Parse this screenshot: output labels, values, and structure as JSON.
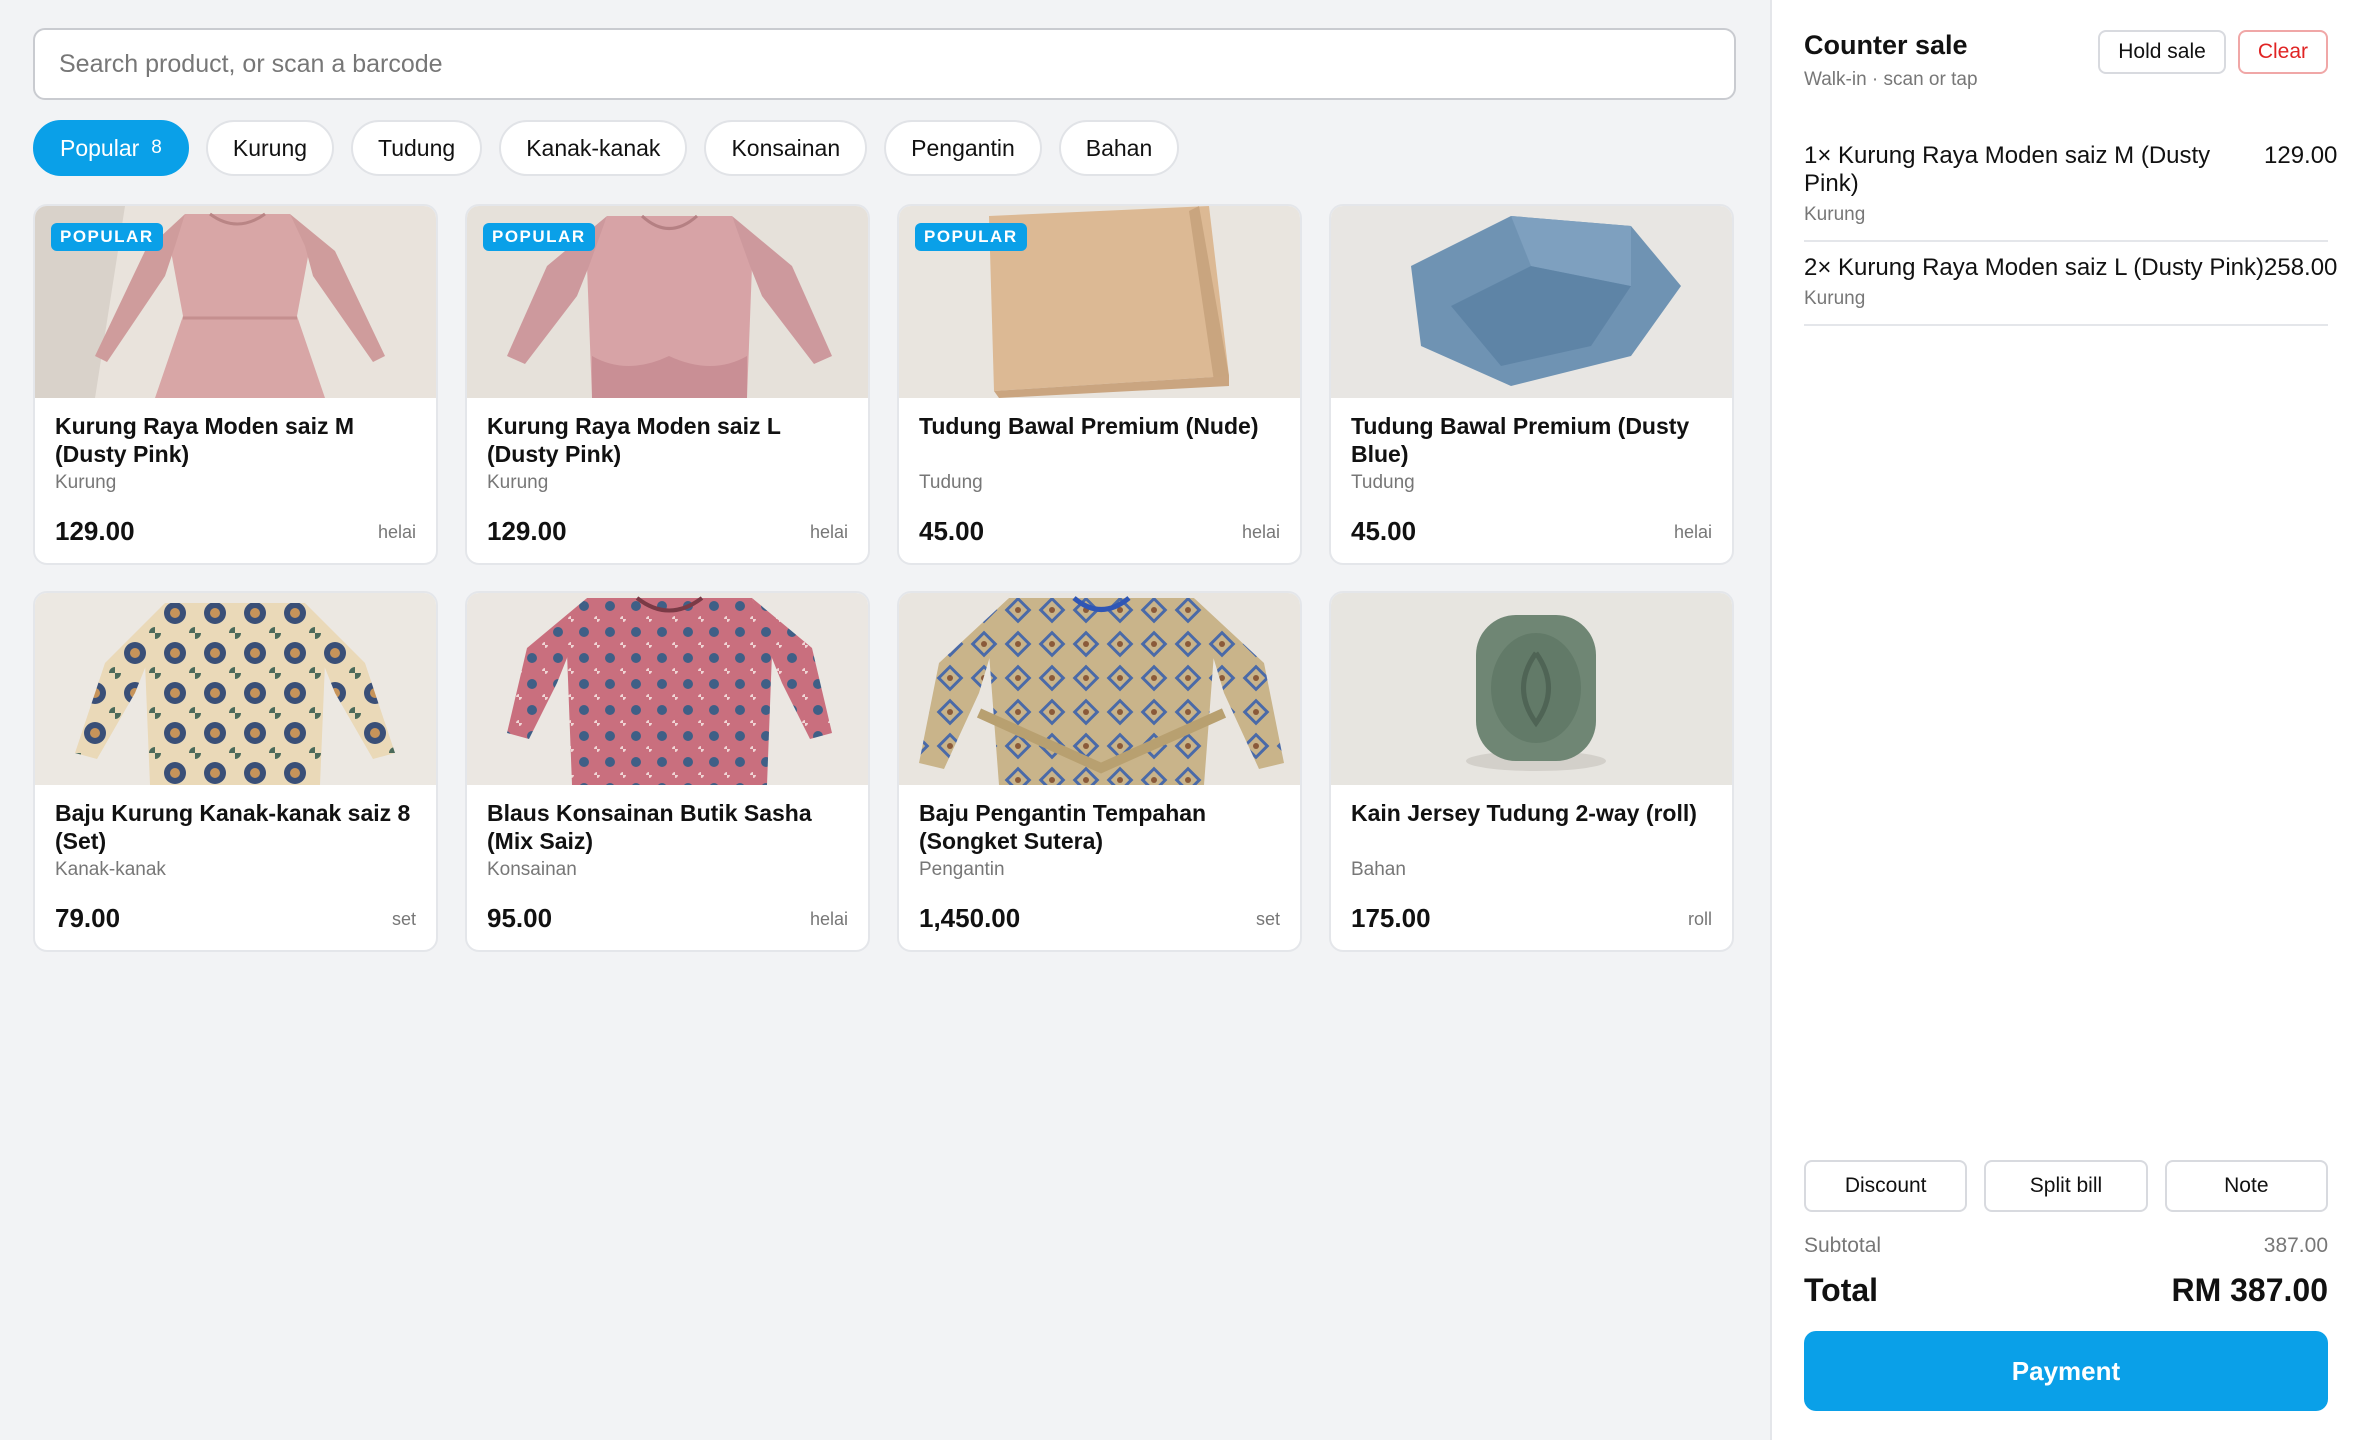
{
  "search": {
    "placeholder": "Search product, or scan a barcode"
  },
  "categories": [
    {
      "label": "Popular",
      "count": "8",
      "active": true
    },
    {
      "label": "Kurung"
    },
    {
      "label": "Tudung"
    },
    {
      "label": "Kanak-kanak"
    },
    {
      "label": "Konsainan"
    },
    {
      "label": "Pengantin"
    },
    {
      "label": "Bahan"
    }
  ],
  "products": [
    {
      "name": "Kurung Raya Moden saiz M (Dusty Pink)",
      "category": "Kurung",
      "price": "129.00",
      "unit": "helai",
      "badge": "POPULAR"
    },
    {
      "name": "Kurung Raya Moden saiz L (Dusty Pink)",
      "category": "Kurung",
      "price": "129.00",
      "unit": "helai",
      "badge": "POPULAR"
    },
    {
      "name": "Tudung Bawal Premium (Nude)",
      "category": "Tudung",
      "price": "45.00",
      "unit": "helai",
      "badge": "POPULAR"
    },
    {
      "name": "Tudung Bawal Premium (Dusty Blue)",
      "category": "Tudung",
      "price": "45.00",
      "unit": "helai"
    },
    {
      "name": "Baju Kurung Kanak-kanak saiz 8 (Set)",
      "category": "Kanak-kanak",
      "price": "79.00",
      "unit": "set"
    },
    {
      "name": "Blaus Konsainan Butik Sasha (Mix Saiz)",
      "category": "Konsainan",
      "price": "95.00",
      "unit": "helai"
    },
    {
      "name": "Baju Pengantin Tempahan (Songket Sutera)",
      "category": "Pengantin",
      "price": "1,450.00",
      "unit": "set"
    },
    {
      "name": "Kain Jersey Tudung 2-way (roll)",
      "category": "Bahan",
      "price": "175.00",
      "unit": "roll"
    }
  ],
  "cart": {
    "title": "Counter sale",
    "subtitle": "Walk-in · scan or tap",
    "hold_label": "Hold sale",
    "clear_label": "Clear",
    "lines": [
      {
        "qty_name": "1× Kurung Raya Moden saiz M (Dusty Pink)",
        "category": "Kurung",
        "amount": "129.00"
      },
      {
        "qty_name": "2× Kurung Raya Moden saiz L (Dusty Pink)",
        "category": "Kurung",
        "amount": "258.00"
      }
    ],
    "discount_label": "Discount",
    "split_label": "Split bill",
    "note_label": "Note",
    "subtotal_label": "Subtotal",
    "subtotal_value": "387.00",
    "total_label": "Total",
    "total_value": "RM 387.00",
    "payment_label": "Payment"
  },
  "colors": {
    "accent": "#0aa0e8",
    "danger": "#e02424"
  }
}
